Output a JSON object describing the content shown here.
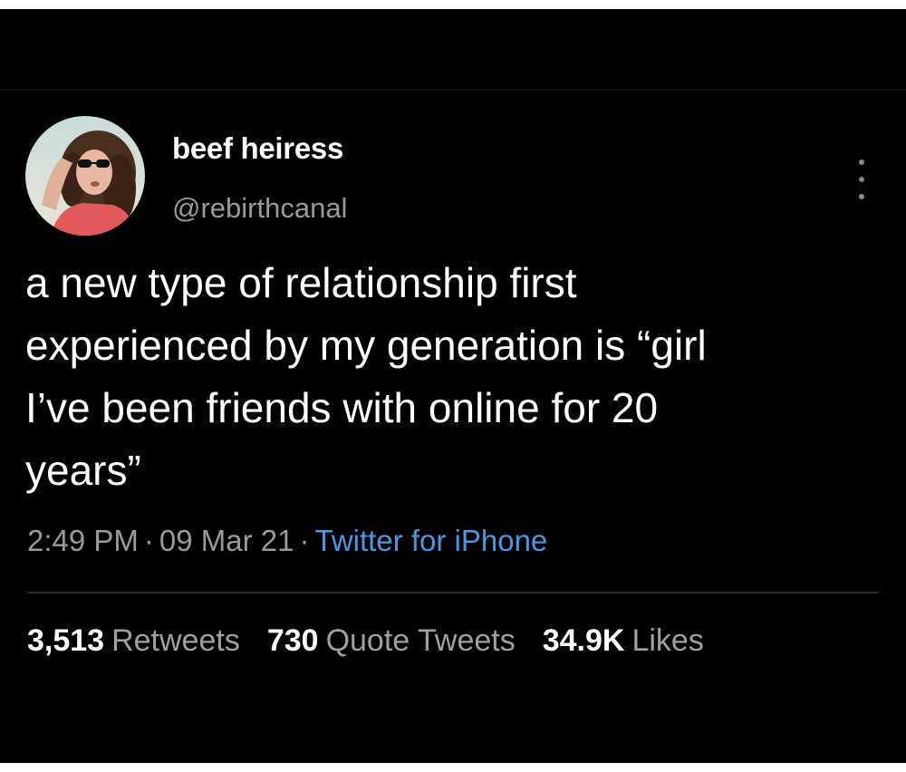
{
  "tweet": {
    "display_name": "beef heiress",
    "handle": "@rebirthcanal",
    "text": "a new type of relationship first\nexperienced by my generation is “girl\nI’ve been friends with online for 20\nyears”",
    "time": "2:49 PM",
    "date": "09 Mar 21",
    "separator": "·",
    "source": "Twitter for iPhone",
    "avatar_icon": "avatar-photo",
    "menu_icon": "more-vertical-icon"
  },
  "stats": {
    "retweets_count": "3,513",
    "retweets_label": "Retweets",
    "quotes_count": "730",
    "quotes_label": "Quote Tweets",
    "likes_count": "34.9K",
    "likes_label": "Likes"
  },
  "colors": {
    "background": "#000000",
    "text": "#ffffff",
    "secondary_text": "#9a9a9a",
    "link": "#4a98e2"
  }
}
